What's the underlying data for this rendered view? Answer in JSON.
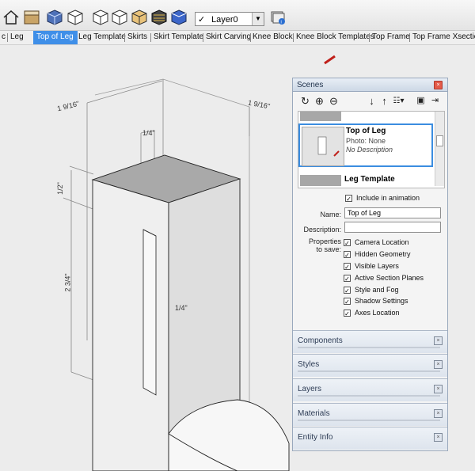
{
  "toolbar": {
    "layer_select": {
      "value": "Layer0",
      "check": "✓"
    },
    "icons": [
      "home-icon",
      "component-icon",
      "iso-view-icon",
      "top-view-icon",
      "front-view-icon",
      "right-view-icon",
      "back-view-icon",
      "left-view-icon",
      "x-ray-icon",
      "wireframe-icon",
      "shaded-icon",
      "layer-manager-icon"
    ]
  },
  "tabs": {
    "items": [
      {
        "label": "c",
        "active": false
      },
      {
        "label": "Leg",
        "active": false
      },
      {
        "label": "Top of Leg",
        "active": true
      },
      {
        "label": "Leg Template",
        "active": false
      },
      {
        "label": "Skirts",
        "active": false
      },
      {
        "label": "Skirt Template",
        "active": false
      },
      {
        "label": "Skirt Carving",
        "active": false
      },
      {
        "label": "Knee Block",
        "active": false
      },
      {
        "label": "Knee Block Templates",
        "active": false
      },
      {
        "label": "Top Frame",
        "active": false
      },
      {
        "label": "Top Frame Xsection",
        "active": false
      }
    ]
  },
  "dimensions": {
    "left_top": "1 9/16\"",
    "right_top": "1 9/16\"",
    "slot_width": "1/4\"",
    "top_depth": "1/2\"",
    "height": "2 3/4\"",
    "slot_depth": "1/4\""
  },
  "scenes": {
    "title": "Scenes",
    "tools": [
      "refresh-icon",
      "add-icon",
      "remove-icon",
      "move-down-icon",
      "move-up-icon",
      "view-options-icon",
      "details-icon",
      "expand-icon"
    ],
    "list": [
      {
        "name": "Top of Leg",
        "photo": "Photo: None",
        "description": "No Description"
      },
      {
        "name": "Leg Template"
      }
    ],
    "include_animation": "Include in animation",
    "name_label": "Name:",
    "name_value": "Top of Leg",
    "description_label": "Description:",
    "description_value": "",
    "properties_label": "Properties",
    "properties_label2": "to save:",
    "properties": [
      "Camera Location",
      "Hidden Geometry",
      "Visible Layers",
      "Active Section Planes",
      "Style and Fog",
      "Shadow Settings",
      "Axes Location"
    ]
  },
  "collapsed_panels": [
    "Components",
    "Styles",
    "Layers",
    "Materials",
    "Entity Info"
  ],
  "colors": {
    "active_tab": "#3f8fe8",
    "selection_border": "#3b8de0"
  }
}
